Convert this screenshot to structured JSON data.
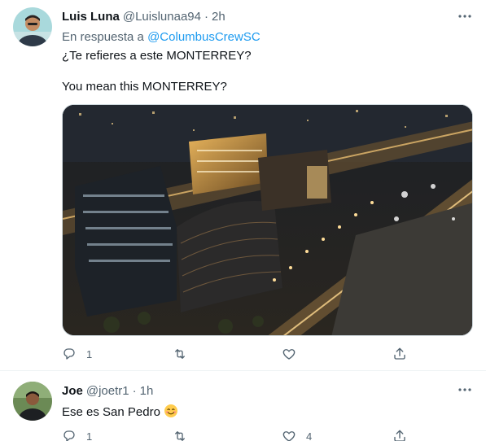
{
  "tweets": [
    {
      "name": "Luis Luna",
      "handle": "@Luislunaa94",
      "separator": "·",
      "time": "2h",
      "reply_prefix": "En respuesta a",
      "reply_mention": "@ColumbusCrewSC",
      "text_line_1": "¿Te refieres a este MONTERREY?",
      "text_line_2": "You mean this MONTERREY?",
      "media": "aerial-night-city-photo",
      "actions": {
        "reply_count": "1",
        "retweet_count": "",
        "like_count": ""
      },
      "avatar_color": "#9fd4d8"
    },
    {
      "name": "Joe",
      "handle": "@joetr1",
      "separator": "·",
      "time": "1h",
      "text": "Ese es San Pedro",
      "emoji": "smiling-face-emoji",
      "actions": {
        "reply_count": "1",
        "retweet_count": "",
        "like_count": "4"
      },
      "avatar_color": "#5f7f4a"
    }
  ],
  "colors": {
    "text": "#0f1419",
    "secondary": "#536471",
    "link": "#1d9bf0",
    "border": "#eff3f4"
  },
  "icons": [
    "more-icon",
    "reply-icon",
    "retweet-icon",
    "like-icon",
    "share-icon"
  ]
}
